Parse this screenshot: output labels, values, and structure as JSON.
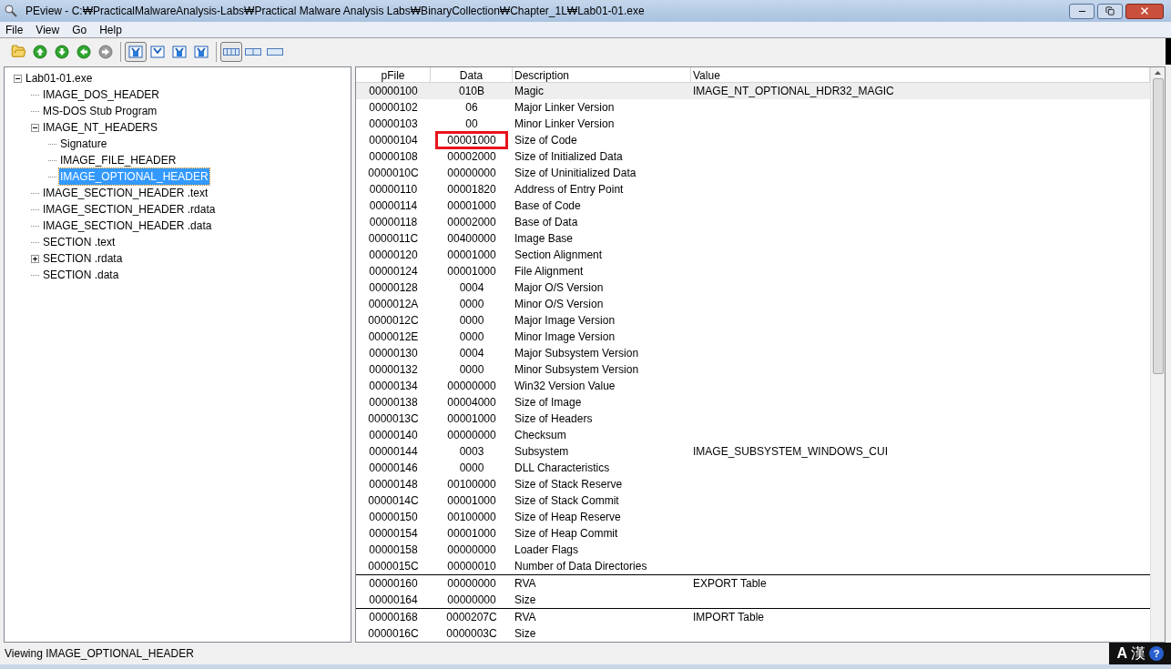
{
  "window": {
    "title": "PEview - C:₩PracticalMalwareAnalysis-Labs₩Practical Malware Analysis Labs₩BinaryCollection₩Chapter_1L₩Lab01-01.exe"
  },
  "menu": [
    "File",
    "View",
    "Go",
    "Help"
  ],
  "toolbar": [
    [
      {
        "kind": "open",
        "selected": false
      },
      {
        "kind": "up",
        "selected": false
      },
      {
        "kind": "down",
        "selected": false
      },
      {
        "kind": "back",
        "selected": false
      },
      {
        "kind": "forward",
        "disabled": true,
        "selected": false
      }
    ],
    [
      {
        "kind": "view1",
        "selected": true
      },
      {
        "kind": "view2",
        "selected": false
      },
      {
        "kind": "view3",
        "selected": false
      },
      {
        "kind": "view4",
        "selected": false
      }
    ],
    [
      {
        "kind": "bytes",
        "selected": true
      },
      {
        "kind": "words",
        "selected": false
      },
      {
        "kind": "dwords",
        "selected": false
      }
    ]
  ],
  "tree": [
    {
      "label": "Lab01-01.exe",
      "selected": false,
      "expanded": true,
      "children": [
        {
          "label": "IMAGE_DOS_HEADER",
          "selected": false
        },
        {
          "label": "MS-DOS Stub Program",
          "selected": false
        },
        {
          "label": "IMAGE_NT_HEADERS",
          "selected": false,
          "expanded": true,
          "children": [
            {
              "label": "Signature",
              "selected": false
            },
            {
              "label": "IMAGE_FILE_HEADER",
              "selected": false
            },
            {
              "label": "IMAGE_OPTIONAL_HEADER",
              "selected": true
            }
          ]
        },
        {
          "label": "IMAGE_SECTION_HEADER .text",
          "selected": false
        },
        {
          "label": "IMAGE_SECTION_HEADER .rdata",
          "selected": false
        },
        {
          "label": "IMAGE_SECTION_HEADER .data",
          "selected": false
        },
        {
          "label": "SECTION .text",
          "selected": false
        },
        {
          "label": "SECTION .rdata",
          "selected": false,
          "expanded": false
        },
        {
          "label": "SECTION .data",
          "selected": false
        }
      ]
    }
  ],
  "table": {
    "columns": [
      "pFile",
      "Data",
      "Description",
      "Value"
    ],
    "groups": [
      {
        "rows": [
          {
            "pfile": "00000100",
            "data": "010B",
            "description": "Magic",
            "value": "IMAGE_NT_OPTIONAL_HDR32_MAGIC",
            "selected": true,
            "highlighted": false
          },
          {
            "pfile": "00000102",
            "data": "06",
            "description": "Major Linker Version",
            "selected": false,
            "highlighted": false
          },
          {
            "pfile": "00000103",
            "data": "00",
            "description": "Minor Linker Version",
            "selected": false,
            "highlighted": false
          },
          {
            "pfile": "00000104",
            "data": "00001000",
            "description": "Size of Code",
            "selected": false,
            "highlighted": true
          },
          {
            "pfile": "00000108",
            "data": "00002000",
            "description": "Size of Initialized Data",
            "selected": false,
            "highlighted": false
          },
          {
            "pfile": "0000010C",
            "data": "00000000",
            "description": "Size of Uninitialized Data",
            "selected": false,
            "highlighted": false
          },
          {
            "pfile": "00000110",
            "data": "00001820",
            "description": "Address of Entry Point",
            "selected": false,
            "highlighted": false
          },
          {
            "pfile": "00000114",
            "data": "00001000",
            "description": "Base of Code",
            "selected": false,
            "highlighted": false
          },
          {
            "pfile": "00000118",
            "data": "00002000",
            "description": "Base of Data",
            "selected": false,
            "highlighted": false
          },
          {
            "pfile": "0000011C",
            "data": "00400000",
            "description": "Image Base",
            "selected": false,
            "highlighted": false
          },
          {
            "pfile": "00000120",
            "data": "00001000",
            "description": "Section Alignment",
            "selected": false,
            "highlighted": false
          },
          {
            "pfile": "00000124",
            "data": "00001000",
            "description": "File Alignment",
            "selected": false,
            "highlighted": false
          },
          {
            "pfile": "00000128",
            "data": "0004",
            "description": "Major O/S Version",
            "selected": false,
            "highlighted": false
          },
          {
            "pfile": "0000012A",
            "data": "0000",
            "description": "Minor O/S Version",
            "selected": false,
            "highlighted": false
          },
          {
            "pfile": "0000012C",
            "data": "0000",
            "description": "Major Image Version",
            "selected": false,
            "highlighted": false
          },
          {
            "pfile": "0000012E",
            "data": "0000",
            "description": "Minor Image Version",
            "selected": false,
            "highlighted": false
          },
          {
            "pfile": "00000130",
            "data": "0004",
            "description": "Major Subsystem Version",
            "selected": false,
            "highlighted": false
          },
          {
            "pfile": "00000132",
            "data": "0000",
            "description": "Minor Subsystem Version",
            "selected": false,
            "highlighted": false
          },
          {
            "pfile": "00000134",
            "data": "00000000",
            "description": "Win32 Version Value",
            "selected": false,
            "highlighted": false
          },
          {
            "pfile": "00000138",
            "data": "00004000",
            "description": "Size of Image",
            "selected": false,
            "highlighted": false
          },
          {
            "pfile": "0000013C",
            "data": "00001000",
            "description": "Size of Headers",
            "selected": false,
            "highlighted": false
          },
          {
            "pfile": "00000140",
            "data": "00000000",
            "description": "Checksum",
            "selected": false,
            "highlighted": false
          },
          {
            "pfile": "00000144",
            "data": "0003",
            "description": "Subsystem",
            "value": "IMAGE_SUBSYSTEM_WINDOWS_CUI",
            "selected": false,
            "highlighted": false
          },
          {
            "pfile": "00000146",
            "data": "0000",
            "description": "DLL Characteristics",
            "selected": false,
            "highlighted": false
          },
          {
            "pfile": "00000148",
            "data": "00100000",
            "description": "Size of Stack Reserve",
            "selected": false,
            "highlighted": false
          },
          {
            "pfile": "0000014C",
            "data": "00001000",
            "description": "Size of Stack Commit",
            "selected": false,
            "highlighted": false
          },
          {
            "pfile": "00000150",
            "data": "00100000",
            "description": "Size of Heap Reserve",
            "selected": false,
            "highlighted": false
          },
          {
            "pfile": "00000154",
            "data": "00001000",
            "description": "Size of Heap Commit",
            "selected": false,
            "highlighted": false
          },
          {
            "pfile": "00000158",
            "data": "00000000",
            "description": "Loader Flags",
            "selected": false,
            "highlighted": false
          },
          {
            "pfile": "0000015C",
            "data": "00000010",
            "description": "Number of Data Directories",
            "selected": false,
            "highlighted": false
          }
        ]
      },
      {
        "rows": [
          {
            "pfile": "00000160",
            "data": "00000000",
            "description": "RVA",
            "value": "EXPORT Table",
            "selected": false,
            "highlighted": false
          },
          {
            "pfile": "00000164",
            "data": "00000000",
            "description": "Size",
            "selected": false,
            "highlighted": false
          }
        ]
      },
      {
        "rows": [
          {
            "pfile": "00000168",
            "data": "0000207C",
            "description": "RVA",
            "value": "IMPORT Table",
            "selected": false,
            "highlighted": false
          },
          {
            "pfile": "0000016C",
            "data": "0000003C",
            "description": "Size",
            "selected": false,
            "highlighted": false
          }
        ]
      }
    ]
  },
  "status_bar": {
    "text": "Viewing IMAGE_OPTIONAL_HEADER"
  },
  "ime": {
    "mode": "A",
    "hanja": "漢",
    "help": "?"
  }
}
